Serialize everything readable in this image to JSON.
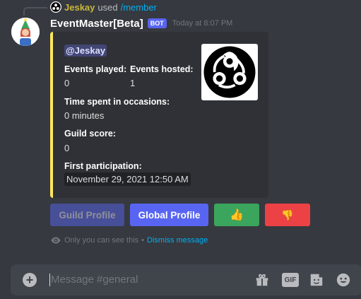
{
  "reply": {
    "user": "Jeskay",
    "used": "used",
    "command": "/member"
  },
  "message": {
    "author": "EventMaster[Beta]",
    "bot_tag": "BOT",
    "timestamp": "Today at 8:07 PM"
  },
  "embed": {
    "accent_color": "#fee75c",
    "mention": "@Jeskay",
    "fields": {
      "events_played_name": "Events played:",
      "events_played_value": "0",
      "events_hosted_name": "Events hosted:",
      "events_hosted_value": "1",
      "time_spent_name": "Time spent in occasions:",
      "time_spent_value": "0 minutes",
      "guild_score_name": "Guild score:",
      "guild_score_value": "0",
      "first_participation_name": "First participation:",
      "first_participation_value": "November 29, 2021 12:50 AM"
    }
  },
  "buttons": {
    "guild_profile": "Guild Profile",
    "global_profile": "Global Profile",
    "thumbs_up": "👍",
    "thumbs_down": "👎"
  },
  "ephemeral": {
    "note": "Only you can see this",
    "separator": "•",
    "dismiss": "Dismiss message"
  },
  "composer": {
    "placeholder": "Message #general",
    "gif_label": "GIF"
  },
  "icons": {
    "eye": "eye-icon",
    "gift": "gift-icon",
    "gif": "gif-icon",
    "sticker": "sticker-icon",
    "emoji": "emoji-icon"
  }
}
